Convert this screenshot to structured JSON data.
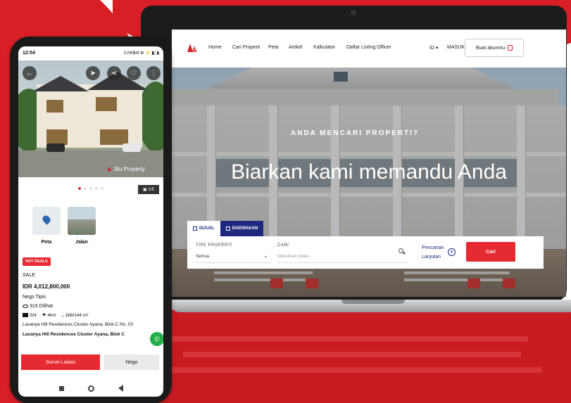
{
  "laptop": {
    "nav": {
      "links": [
        "Home",
        "Cari Properti",
        "Peta",
        "Artikel",
        "Kalkulator",
        "Daftar Listing Officer"
      ],
      "lang": "ID",
      "login": "MASUK",
      "create_account": "Buat akunmu"
    },
    "hero": {
      "subtitle": "ANDA MENCARI PROPERTI?",
      "title": "Biarkan kami memandu Anda"
    },
    "search": {
      "tabs": [
        {
          "label": "DIJUAL",
          "active": false
        },
        {
          "label": "DISEWAKAN",
          "active": true
        }
      ],
      "type_label": "TIPE PROPERTI",
      "type_value": "Semua",
      "query_label": "CARI",
      "query_placeholder": "Masukkan lokasi...",
      "advanced_line1": "Pencarian",
      "advanced_line2": "Lanjutan",
      "submit": "Cari"
    },
    "colors": {
      "brand_red": "#e52a31",
      "navy": "#1e2a80"
    }
  },
  "phone": {
    "status": {
      "time": "12:54",
      "indicators": "0,0KB/d ⚙ ⚡ ◧ ▮"
    },
    "photo": {
      "watermark": "Jitu Property",
      "counter": "1/5"
    },
    "thumbs": [
      {
        "label": "Peta",
        "icon": "map-pin-icon"
      },
      {
        "label": "Jalan",
        "icon": "street-view-image"
      }
    ],
    "badge": "HOT DEALS",
    "listing_type": "SALE",
    "price": "IDR 4,012,800,000",
    "price_note": "Nego Tipis",
    "views": "319 Dilihat",
    "specs": {
      "cert": "Sht",
      "distance": "4km",
      "area": "168/144 m²"
    },
    "address": "Lavanya Hill Residences Cluster Ayana, Blok C No. 03",
    "title": "Lavanya Hill Residences Cluster Ayana, Blok C",
    "cta_primary": "Survei Lokasi",
    "cta_secondary": "Nego"
  }
}
